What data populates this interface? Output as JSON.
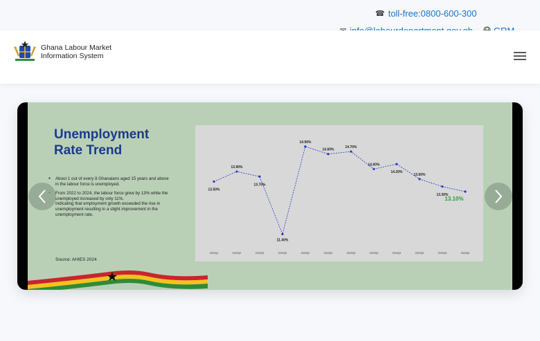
{
  "topbar": {
    "phone": "toll-free:0800-600-300",
    "email": "info@labourdepartment.gov.gh",
    "language": "GRM"
  },
  "header": {
    "brand_line1": "Ghana Labour Market",
    "brand_line2": "Information System"
  },
  "slide": {
    "title_line1": "Unemployment",
    "title_line2": "Rate Trend",
    "bullet1": "About 1 out of every 8 Ghanaians aged 15 years and above in the labour force is unemployed.",
    "bullet2": "From 2022 to 2024, the labour force grew by 13% while the unemployed increased by only 11%.",
    "bullet2_cont": "Indicating that employment growth exceeded the rise in unemployment resulting in a slight improvement in the unemployment rate.",
    "source": "Source: AHIES 2024"
  },
  "chart_data": {
    "type": "line",
    "x": [
      "2022Q1",
      "2022Q2",
      "2022Q3",
      "2022Q4",
      "2023Q1",
      "2023Q2",
      "2023Q3",
      "2023Q4",
      "2024Q1",
      "2024Q2",
      "2024Q3",
      "2024Q4"
    ],
    "series": [
      {
        "values": [
          13.5,
          13.9,
          13.7,
          11.4,
          14.9,
          14.6,
          14.7,
          14.0,
          14.2,
          13.6,
          13.3,
          13.1
        ]
      }
    ],
    "labels": [
      "13.50%",
      "13.90%",
      "13.70%",
      "11.40%",
      "14.90%",
      "14.60%",
      "14.70%",
      "14.00%",
      "14.20%",
      "13.60%",
      "13.30%",
      "13.10%"
    ],
    "ylim": [
      11.0,
      15.2
    ],
    "colors": {
      "line": "#2633c9",
      "last_label": "#2e9a3a"
    }
  },
  "icons": {
    "phone": "phone-icon",
    "email": "envelope-icon",
    "language": "globe-icon",
    "menu": "hamburger-menu-icon",
    "prev": "chevron-left-icon",
    "next": "chevron-right-icon"
  }
}
